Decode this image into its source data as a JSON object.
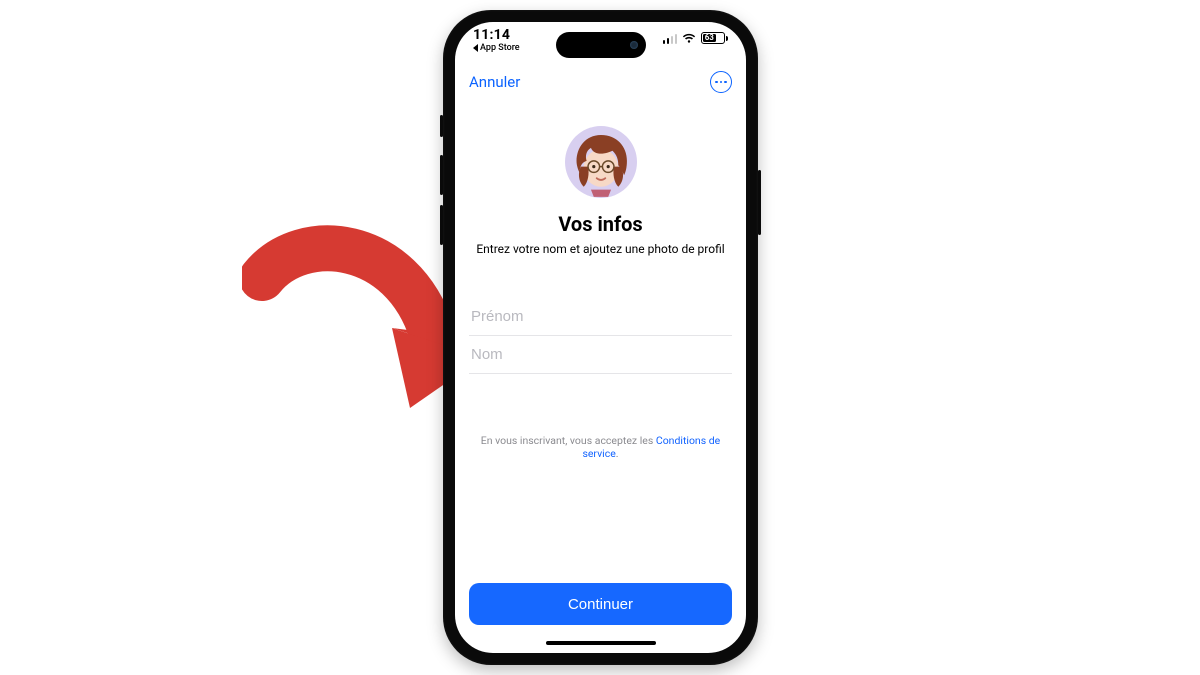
{
  "status": {
    "time": "11:14",
    "back_app": "App Store",
    "battery_pct": "63"
  },
  "nav": {
    "cancel": "Annuler"
  },
  "page": {
    "title": "Vos infos",
    "subtitle": "Entrez votre nom et ajoutez une photo de profil"
  },
  "form": {
    "first_name_placeholder": "Prénom",
    "last_name_placeholder": "Nom",
    "first_name_value": "",
    "last_name_value": ""
  },
  "terms": {
    "prefix": "En vous inscrivant, vous acceptez les ",
    "link": "Conditions de service",
    "suffix": "."
  },
  "cta": {
    "continue": "Continuer"
  }
}
